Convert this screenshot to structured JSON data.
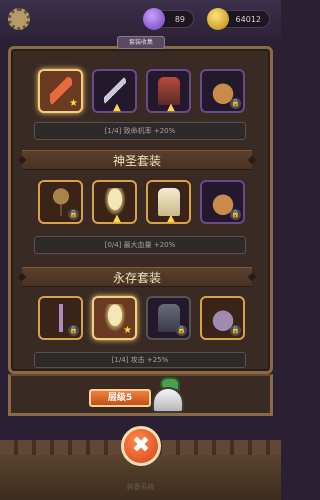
{
  "currency": {
    "gems": "89",
    "gold": "64012"
  },
  "panel_tab": "套装收集",
  "sets": [
    {
      "name": "",
      "bonus": "[1/4] 致命机率 +20%",
      "items": [
        {
          "icon": "red-sword-icon",
          "state": "selected-star"
        },
        {
          "icon": "gold-sword-icon",
          "state": "upgrade"
        },
        {
          "icon": "red-armor-icon",
          "state": "upgrade"
        },
        {
          "icon": "red-helmet-icon",
          "state": "locked"
        }
      ]
    },
    {
      "name": "神圣套装",
      "bonus": "[0/4] 最大血量 +20%",
      "items": [
        {
          "icon": "mace-icon",
          "state": "locked"
        },
        {
          "icon": "holy-shield-icon",
          "state": "upgrade"
        },
        {
          "icon": "white-armor-icon",
          "state": "upgrade"
        },
        {
          "icon": "bronze-helmet-icon",
          "state": "locked"
        }
      ]
    },
    {
      "name": "永存套装",
      "bonus": "[1/4] 攻击 +25%",
      "items": [
        {
          "icon": "purple-dagger-icon",
          "state": "locked"
        },
        {
          "icon": "eternal-shield-icon",
          "state": "selected-star"
        },
        {
          "icon": "dark-armor-icon",
          "state": "locked"
        },
        {
          "icon": "purple-helmet-icon",
          "state": "locked"
        }
      ]
    }
  ],
  "level_button": "层级5",
  "close_symbol": "✖",
  "footer": "装备系统",
  "glyphs": {
    "lock": "🔒",
    "star": "★",
    "up": "▲"
  }
}
